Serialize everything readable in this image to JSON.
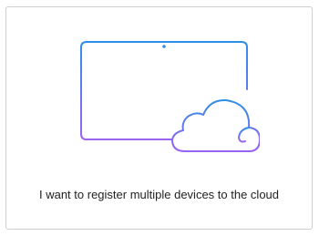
{
  "option_card": {
    "label": "I want to register multiple devices to the cloud",
    "illustration_icon": "tablet-with-cloud-icon",
    "gradient": {
      "top": "#2f8fe6",
      "bottom": "#9a63f0"
    }
  }
}
